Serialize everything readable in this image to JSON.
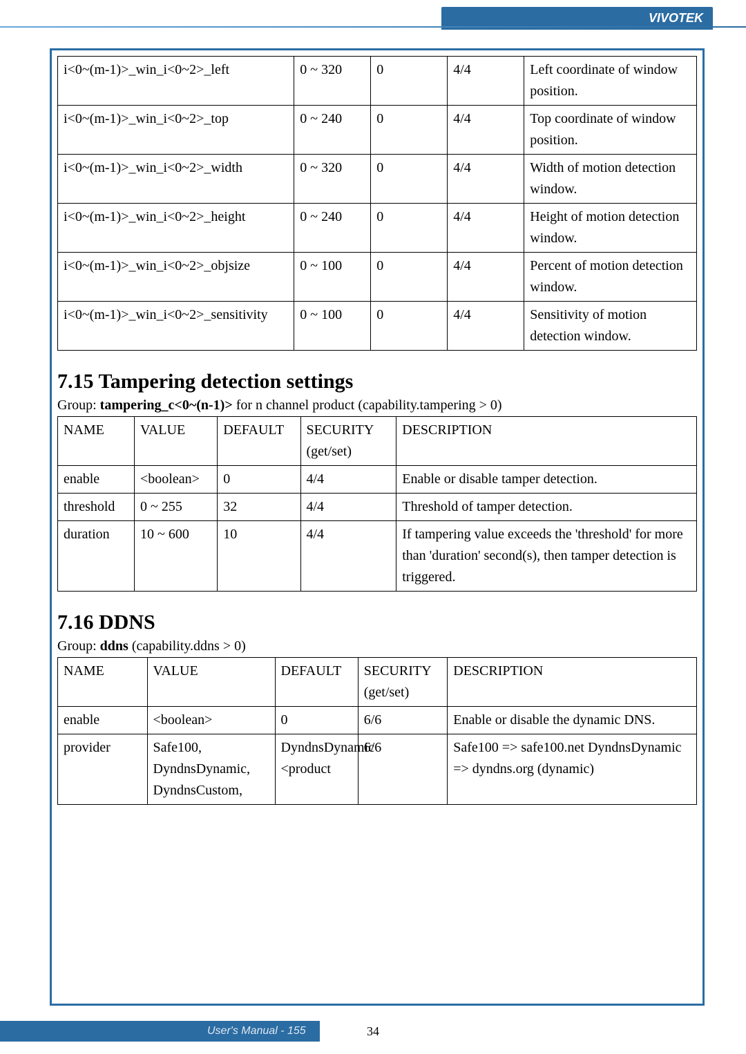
{
  "brand": "VIVOTEK",
  "table1": {
    "rows": [
      {
        "name": "i<0~(m-1)>_win_i<0~2>_left",
        "value": "0 ~ 320",
        "def": "0",
        "sec": "4/4",
        "desc": "Left coordinate of window position."
      },
      {
        "name": "i<0~(m-1)>_win_i<0~2>_top",
        "value": "0 ~ 240",
        "def": "0",
        "sec": "4/4",
        "desc": "Top coordinate of window position."
      },
      {
        "name": "i<0~(m-1)>_win_i<0~2>_width",
        "value": "0 ~ 320",
        "def": "0",
        "sec": "4/4",
        "desc": "Width of motion detection window."
      },
      {
        "name": "i<0~(m-1)>_win_i<0~2>_height",
        "value": "0 ~ 240",
        "def": "0",
        "sec": "4/4",
        "desc": "Height of motion detection window."
      },
      {
        "name": "i<0~(m-1)>_win_i<0~2>_objsize",
        "value": "0 ~ 100",
        "def": "0",
        "sec": "4/4",
        "desc": "Percent of motion detection window."
      },
      {
        "name": "i<0~(m-1)>_win_i<0~2>_sensitivity",
        "value": "0 ~ 100",
        "def": "0",
        "sec": "4/4",
        "desc": "Sensitivity of motion detection window."
      }
    ]
  },
  "sec715": {
    "heading": "7.15 Tampering detection settings",
    "group_prefix": "Group: ",
    "group_bold": "tampering_c<0~(n-1)>",
    "group_suffix": " for n channel product (capability.tampering > 0)",
    "headers": {
      "name": "NAME",
      "value": "VALUE",
      "def": "DEFAULT",
      "sec": "SECURITY (get/set)",
      "desc": "DESCRIPTION"
    },
    "rows": [
      {
        "name": "enable",
        "value": "<boolean>",
        "def": "0",
        "sec": "4/4",
        "desc": "Enable or disable tamper detection."
      },
      {
        "name": "threshold",
        "value": "0 ~ 255",
        "def": "32",
        "sec": "4/4",
        "desc": "Threshold of tamper detection."
      },
      {
        "name": "duration",
        "value": "10 ~ 600",
        "def": "10",
        "sec": "4/4",
        "desc": "If tampering value exceeds the 'threshold' for more than 'duration' second(s), then tamper detection is triggered."
      }
    ]
  },
  "sec716": {
    "heading": "7.16 DDNS",
    "group_prefix": "Group: ",
    "group_bold": "ddns",
    "group_suffix": " (capability.ddns > 0)",
    "headers": {
      "name": "NAME",
      "value": "VALUE",
      "def": "DEFAULT",
      "sec": "SECURITY (get/set)",
      "desc": "DESCRIPTION"
    },
    "rows": [
      {
        "name": "enable",
        "value": "<boolean>",
        "def": "0",
        "sec": "6/6",
        "desc": "Enable or disable the dynamic DNS."
      },
      {
        "name": "provider",
        "value": "Safe100, DyndnsDynamic, DyndnsCustom,",
        "def": "DyndnsDynamic <product",
        "sec": "6/6",
        "desc": "Safe100 => safe100.net DyndnsDynamic => dyndns.org (dynamic)"
      }
    ]
  },
  "footer": {
    "center": "34",
    "right": "User's Manual - 155"
  }
}
